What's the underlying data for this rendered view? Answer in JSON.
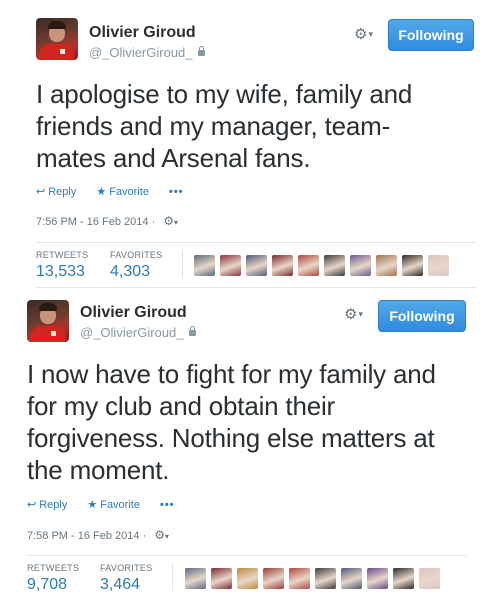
{
  "tweets": [
    {
      "user": {
        "name": "Olivier Giroud",
        "handle": "@_OlivierGiroud_"
      },
      "follow_label": "Following",
      "text_lines": [
        "I apologise to my wife, family and",
        "friends and my manager, team-",
        "mates and Arsenal fans."
      ],
      "actions": {
        "reply": "Reply",
        "favorite": "Favorite",
        "more": "•••"
      },
      "timestamp": "7:56 PM - 16 Feb 2014 ·",
      "stats": {
        "retweets_label": "RETWEETS",
        "retweets": "13,533",
        "favorites_label": "FAVORITES",
        "favorites": "4,303"
      },
      "favoriter_colors": [
        "#5a6b7c",
        "#8a3340",
        "#4c5a78",
        "#7a2a30",
        "#b0483c",
        "#3a3a3a",
        "#6a5b8c",
        "#a07050",
        "#2a2a2a",
        "#d8c6c8"
      ]
    },
    {
      "user": {
        "name": "Olivier Giroud",
        "handle": "@_OlivierGiroud_"
      },
      "follow_label": "Following",
      "text_lines": [
        "I now have to fight for my family and",
        "for my club and obtain their",
        "forgiveness. Nothing else matters at",
        "the moment."
      ],
      "actions": {
        "reply": "Reply",
        "favorite": "Favorite",
        "more": "•••"
      },
      "timestamp": "7:58 PM - 16 Feb 2014 ·",
      "stats": {
        "retweets_label": "RETWEETS",
        "retweets": "9,708",
        "favorites_label": "FAVORITES",
        "favorites": "3,464"
      },
      "favoriter_colors": [
        "#5a6b7c",
        "#7a2a30",
        "#c08a3a",
        "#9a3a3a",
        "#b0483c",
        "#3a3a3a",
        "#4c5a78",
        "#6a4a8c",
        "#2a2a2a",
        "#d8c6c8"
      ]
    }
  ],
  "icons": {
    "gear": "⚙",
    "caret": "▾",
    "reply": "↩",
    "favorite": "★"
  },
  "colors": {
    "link_blue": "#2b7bb9",
    "follow_button": "#3b99e6",
    "muted_gray": "#8899a6"
  }
}
